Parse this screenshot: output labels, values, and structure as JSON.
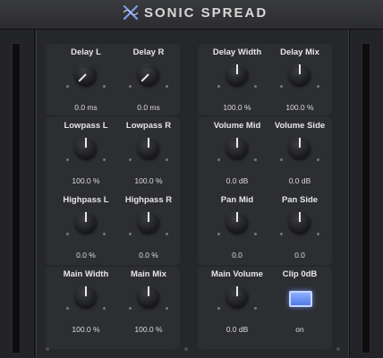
{
  "app": {
    "title": "SONIC SPREAD",
    "logo_icon": "x-wave-icon"
  },
  "colors": {
    "accent": "#6d90f0",
    "panel": "#2d2e31",
    "background": "#26272a"
  },
  "groups": [
    {
      "controls": [
        {
          "id": "delay-l",
          "label": "Delay L",
          "value": "0.0 ms",
          "level": 0.0
        },
        {
          "id": "delay-r",
          "label": "Delay R",
          "value": "0.0 ms",
          "level": 0.0
        }
      ]
    },
    {
      "controls": [
        {
          "id": "delay-width",
          "label": "Delay Width",
          "value": "100.0 %",
          "level": 0.5
        },
        {
          "id": "delay-mix",
          "label": "Delay Mix",
          "value": "100.0 %",
          "level": 0.5
        }
      ]
    },
    {
      "controls": [
        {
          "id": "lowpass-l",
          "label": "Lowpass L",
          "value": "100.0 %",
          "level": 0.5
        },
        {
          "id": "lowpass-r",
          "label": "Lowpass R",
          "value": "100.0 %",
          "level": 0.5
        },
        {
          "id": "highpass-l",
          "label": "Highpass L",
          "value": "0.0 %",
          "level": 0.5
        },
        {
          "id": "highpass-r",
          "label": "Highpass R",
          "value": "0.0 %",
          "level": 0.5
        }
      ]
    },
    {
      "controls": [
        {
          "id": "volume-mid",
          "label": "Volume Mid",
          "value": "0.0 dB",
          "level": 0.5
        },
        {
          "id": "volume-side",
          "label": "Volume Side",
          "value": "0.0 dB",
          "level": 0.5
        },
        {
          "id": "pan-mid",
          "label": "Pan Mid",
          "value": "0.0",
          "level": 0.5
        },
        {
          "id": "pan-side",
          "label": "Pan Side",
          "value": "0.0",
          "level": 0.5
        }
      ]
    },
    {
      "controls": [
        {
          "id": "main-width",
          "label": "Main Width",
          "value": "100.0 %",
          "level": 0.5
        },
        {
          "id": "main-mix",
          "label": "Main Mix",
          "value": "100.0 %",
          "level": 0.5
        }
      ]
    },
    {
      "controls": [
        {
          "id": "main-volume",
          "label": "Main Volume",
          "value": "0.0 dB",
          "level": 0.5
        },
        {
          "id": "clip-0db",
          "label": "Clip 0dB",
          "value": "on",
          "toggle": true
        }
      ]
    }
  ]
}
